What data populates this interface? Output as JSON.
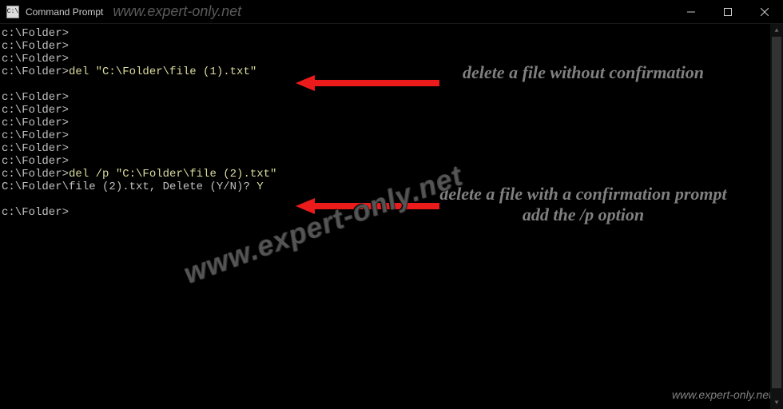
{
  "window": {
    "title": "Command Prompt",
    "watermark_top": "www.expert-only.net"
  },
  "terminal": {
    "prompt": "c:\\Folder>",
    "prompt_upper": "C:\\Folder>",
    "lines": [
      {
        "p": "c:\\Folder>",
        "cmd": ""
      },
      {
        "p": "c:\\Folder>",
        "cmd": ""
      },
      {
        "p": "c:\\Folder>",
        "cmd": ""
      },
      {
        "p": "c:\\Folder>",
        "cmd": "del \"C:\\Folder\\file (1).txt\""
      },
      {
        "p": "",
        "cmd": ""
      },
      {
        "p": "c:\\Folder>",
        "cmd": ""
      },
      {
        "p": "c:\\Folder>",
        "cmd": ""
      },
      {
        "p": "c:\\Folder>",
        "cmd": ""
      },
      {
        "p": "c:\\Folder>",
        "cmd": ""
      },
      {
        "p": "c:\\Folder>",
        "cmd": ""
      },
      {
        "p": "c:\\Folder>",
        "cmd": ""
      },
      {
        "p": "c:\\Folder>",
        "cmd": "del /p \"C:\\Folder\\file (2).txt\""
      }
    ],
    "confirm_line_prefix": "C:\\Folder\\file (2).txt, Delete (Y/N)? ",
    "confirm_answer": "Y",
    "trailing_prompt": "c:\\Folder>"
  },
  "annotations": {
    "first": "delete a file without confirmation",
    "second": "delete a file with a confirmation prompt add the /p option"
  },
  "watermark_diag": "www.expert-only.net",
  "watermark_bottom": "www.expert-only.net"
}
